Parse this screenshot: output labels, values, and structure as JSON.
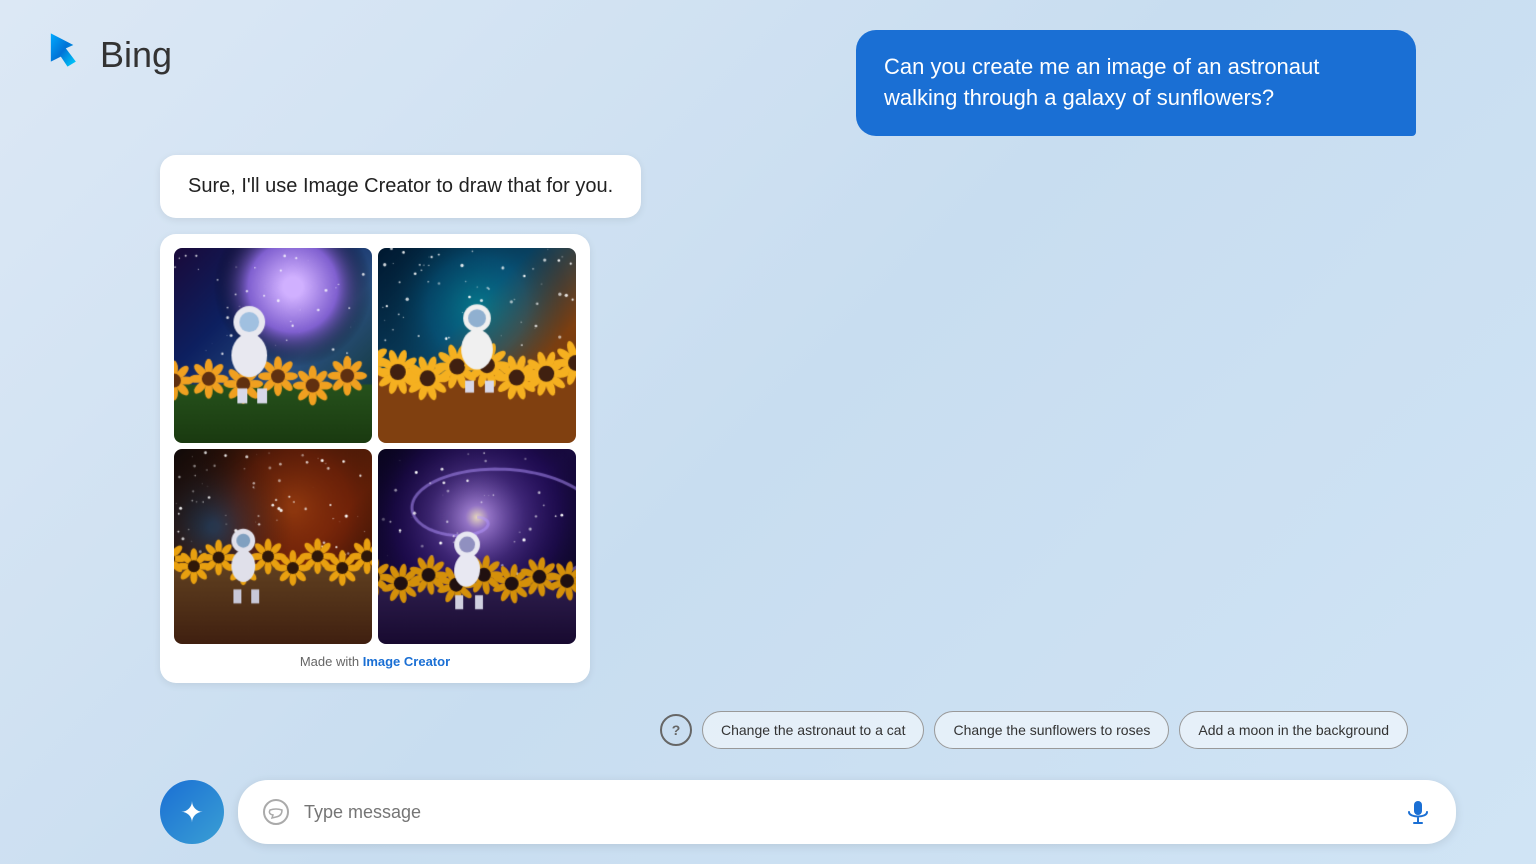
{
  "header": {
    "logo_text": "Bing",
    "logo_icon": "b-icon"
  },
  "chat": {
    "user_message": "Can you create me an image of an astronaut walking through a galaxy of sunflowers?",
    "ai_text": "Sure, I'll use Image Creator to draw that for you.",
    "image_caption_prefix": "Made with",
    "image_creator_link": "Image Creator"
  },
  "suggestions": {
    "help_icon": "?",
    "chips": [
      {
        "label": "Change the astronaut to a cat"
      },
      {
        "label": "Change the sunflowers to roses"
      },
      {
        "label": "Add a moon in the background"
      }
    ]
  },
  "input": {
    "placeholder": "Type message",
    "sparkle_icon": "✦",
    "mic_icon": "mic"
  }
}
